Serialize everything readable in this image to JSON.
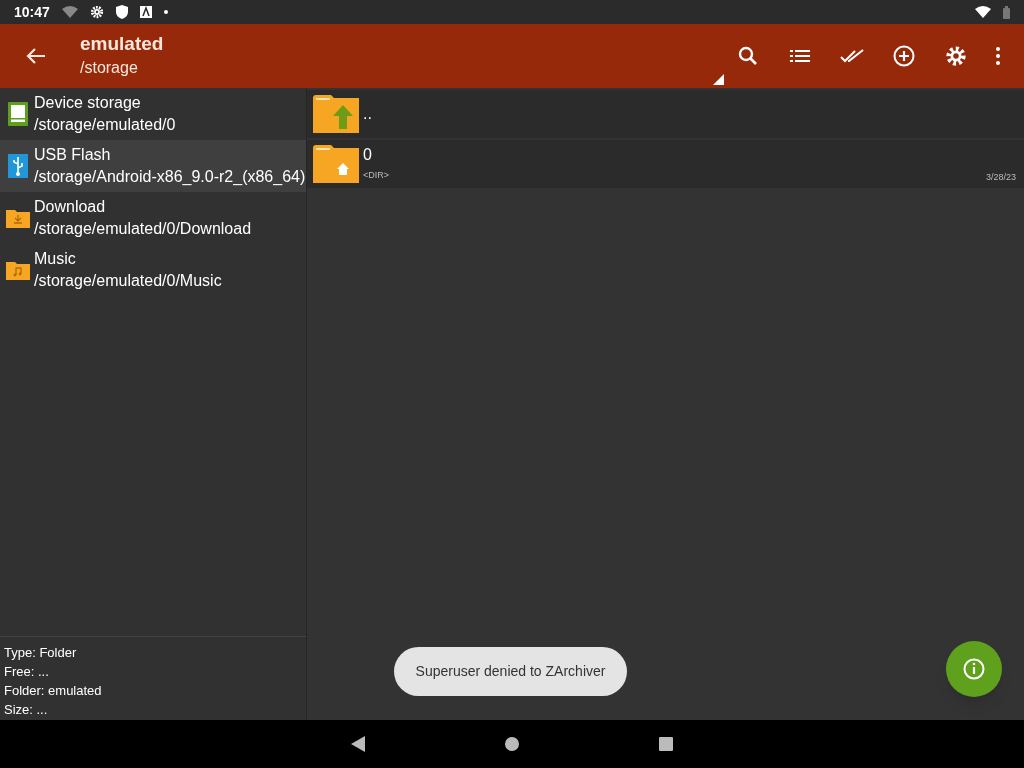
{
  "status_bar": {
    "time": "10:47"
  },
  "app_bar": {
    "title": "emulated",
    "subtitle": "/storage"
  },
  "sidebar": {
    "items": [
      {
        "kind": "device",
        "name": "Device storage",
        "path": "/storage/emulated/0",
        "selected": false
      },
      {
        "kind": "usb",
        "name": "USB Flash",
        "path": "/storage/Android-x86_9.0-r2_(x86_64)",
        "selected": true
      },
      {
        "kind": "download",
        "name": "Download",
        "path": "/storage/emulated/0/Download",
        "selected": false
      },
      {
        "kind": "music",
        "name": "Music",
        "path": "/storage/emulated/0/Music",
        "selected": false
      }
    ]
  },
  "info": [
    "Type: Folder",
    "Free: ...",
    "Folder: emulated",
    "Size: ..."
  ],
  "files": [
    {
      "kind": "up",
      "name": ".."
    },
    {
      "kind": "home",
      "name": "0",
      "type": "<DIR>",
      "date": "3/28/23"
    }
  ],
  "toast": "Superuser denied to ZArchiver"
}
